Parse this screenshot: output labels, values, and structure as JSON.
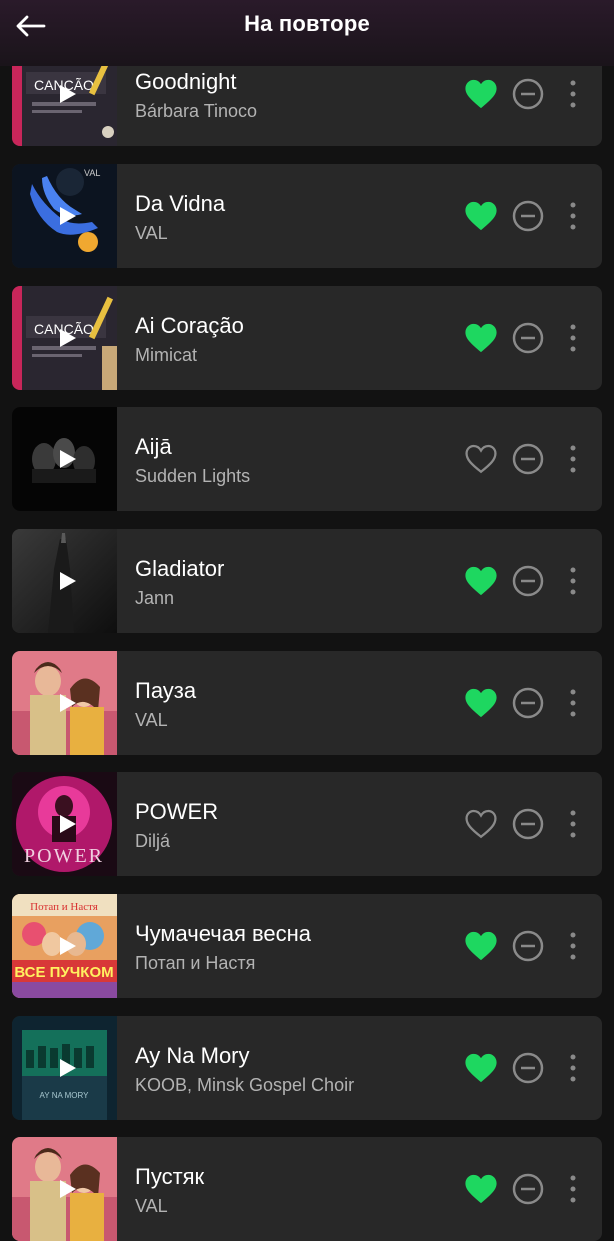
{
  "header": {
    "title": "На повторе",
    "back_icon": "arrow-left-icon"
  },
  "colors": {
    "liked": "#1ed760",
    "icon_muted": "#8a8a8a",
    "card_bg": "#282828",
    "secondary_text": "#b3b3b3"
  },
  "tracks": [
    {
      "title": "Goodnight",
      "artist": "Bárbara Tinoco",
      "liked": true
    },
    {
      "title": "Da Vidna",
      "artist": "VAL",
      "liked": true
    },
    {
      "title": "Ai Coração",
      "artist": "Mimicat",
      "liked": true
    },
    {
      "title": "Aijā",
      "artist": "Sudden Lights",
      "liked": false
    },
    {
      "title": "Gladiator",
      "artist": "Jann",
      "liked": true
    },
    {
      "title": "Пауза",
      "artist": "VAL",
      "liked": true
    },
    {
      "title": "POWER",
      "artist": "Diljá",
      "liked": false
    },
    {
      "title": "Чумачечая весна",
      "artist": "Потап и Настя",
      "liked": true
    },
    {
      "title": "Ay Na Mory",
      "artist": "KOOB, Minsk Gospel Choir",
      "liked": true
    },
    {
      "title": "Пустяк",
      "artist": "VAL",
      "liked": true
    }
  ]
}
